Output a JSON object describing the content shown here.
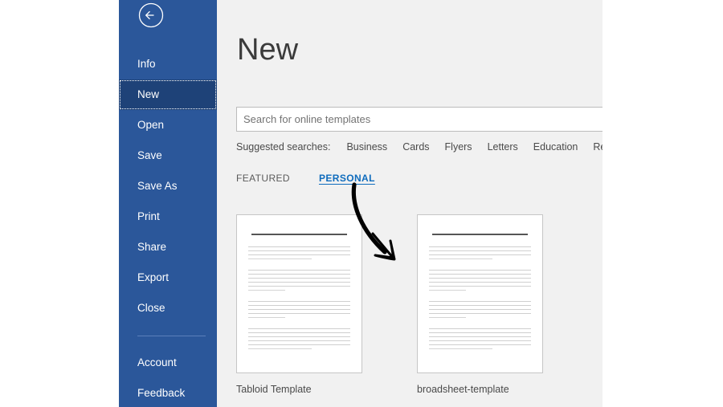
{
  "sidebar": {
    "back_icon": "back-arrow-circle-icon",
    "items": [
      {
        "label": "Info",
        "selected": false,
        "sep_after": false
      },
      {
        "label": "New",
        "selected": true,
        "sep_after": false
      },
      {
        "label": "Open",
        "selected": false,
        "sep_after": false
      },
      {
        "label": "Save",
        "selected": false,
        "sep_after": false
      },
      {
        "label": "Save As",
        "selected": false,
        "sep_after": false
      },
      {
        "label": "Print",
        "selected": false,
        "sep_after": false
      },
      {
        "label": "Share",
        "selected": false,
        "sep_after": false
      },
      {
        "label": "Export",
        "selected": false,
        "sep_after": false
      },
      {
        "label": "Close",
        "selected": false,
        "sep_after": true
      },
      {
        "label": "Account",
        "selected": false,
        "sep_after": false
      },
      {
        "label": "Feedback",
        "selected": false,
        "sep_after": false
      }
    ]
  },
  "main": {
    "title": "New",
    "search": {
      "placeholder": "Search for online templates",
      "value": ""
    },
    "suggested": {
      "label": "Suggested searches:",
      "links": [
        "Business",
        "Cards",
        "Flyers",
        "Letters",
        "Education",
        "Resum"
      ]
    },
    "tabs": [
      {
        "label": "FEATURED",
        "active": false
      },
      {
        "label": "PERSONAL",
        "active": true
      }
    ],
    "templates": [
      {
        "label": "Tabloid Template"
      },
      {
        "label": "broadsheet-template"
      }
    ]
  },
  "annotation": {
    "arrow_name": "hand-drawn-arrow-annotation"
  },
  "colors": {
    "sidebar_blue": "#2b579a",
    "sidebar_selected": "#1e4278",
    "accent_link": "#0f6cbd",
    "content_bg": "#f1f1f1"
  }
}
